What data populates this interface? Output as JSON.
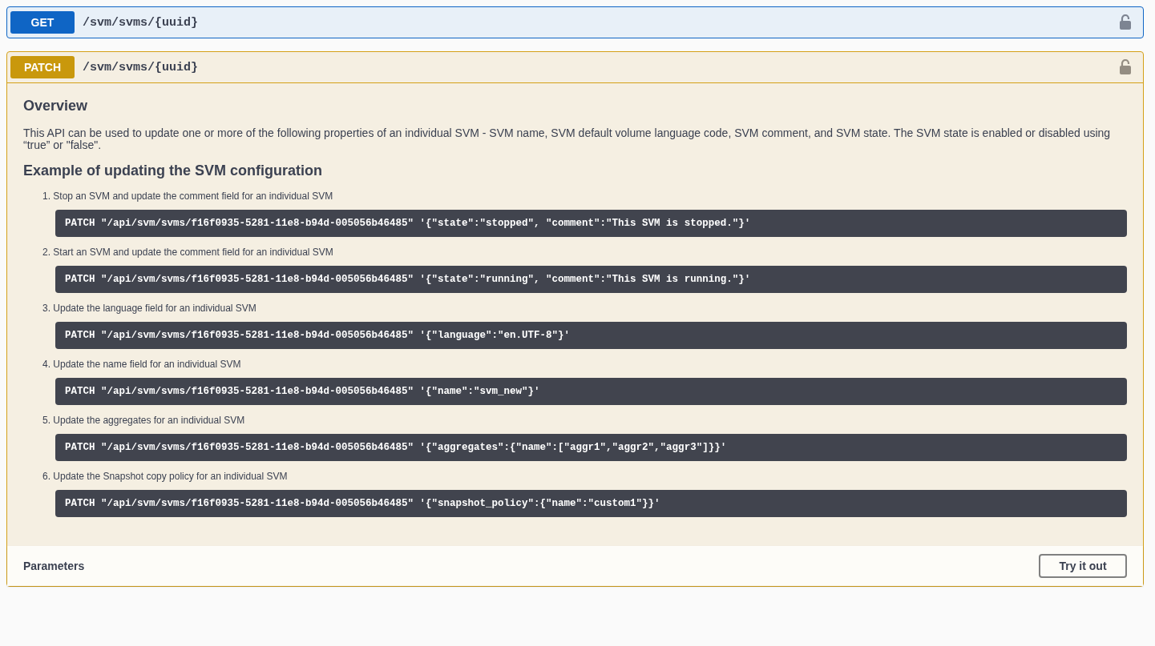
{
  "operations": [
    {
      "kind": "get",
      "method": "GET",
      "path": "/svm/svms/{uuid}"
    },
    {
      "kind": "patch",
      "method": "PATCH",
      "path": "/svm/svms/{uuid}",
      "overview": {
        "title": "Overview",
        "text": "This API can be used to update one or more of the following properties of an individual SVM - SVM name, SVM default volume language code, SVM comment, and SVM state. The SVM state is enabled or disabled using “true” or \"false\".",
        "example_title": "Example of updating the SVM configuration",
        "examples": [
          {
            "number": "1.",
            "text": "Stop an SVM and update the comment field for an individual SVM",
            "code": "PATCH \"/api/svm/svms/f16f0935-5281-11e8-b94d-005056b46485\" '{\"state\":\"stopped\", \"comment\":\"This SVM is stopped.\"}'"
          },
          {
            "number": "2.",
            "text": "Start an SVM and update the comment field for an individual SVM",
            "code": "PATCH \"/api/svm/svms/f16f0935-5281-11e8-b94d-005056b46485\" '{\"state\":\"running\", \"comment\":\"This SVM is running.\"}'"
          },
          {
            "number": "3.",
            "text": "Update the language field for an individual SVM",
            "code": "PATCH \"/api/svm/svms/f16f0935-5281-11e8-b94d-005056b46485\" '{\"language\":\"en.UTF-8\"}'"
          },
          {
            "number": "4.",
            "text": "Update the name field for an individual SVM",
            "code": "PATCH \"/api/svm/svms/f16f0935-5281-11e8-b94d-005056b46485\" '{\"name\":\"svm_new\"}'"
          },
          {
            "number": "5.",
            "text": "Update the aggregates for an individual SVM",
            "code": "PATCH \"/api/svm/svms/f16f0935-5281-11e8-b94d-005056b46485\" '{\"aggregates\":{\"name\":[\"aggr1\",\"aggr2\",\"aggr3\"]}}'"
          },
          {
            "number": "6.",
            "text": "Update the Snapshot copy policy for an individual SVM",
            "code": "PATCH \"/api/svm/svms/f16f0935-5281-11e8-b94d-005056b46485\" '{\"snapshot_policy\":{\"name\":\"custom1\"}}'"
          }
        ]
      },
      "parameters": {
        "title": "Parameters",
        "button": "Try it out"
      }
    }
  ]
}
